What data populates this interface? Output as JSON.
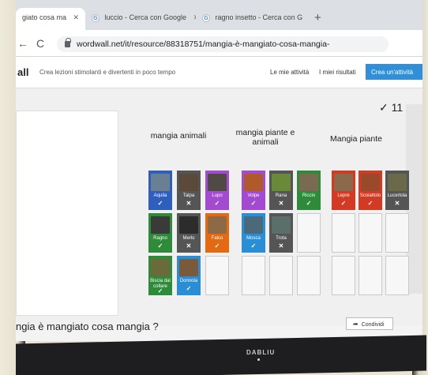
{
  "browser": {
    "tabs": [
      {
        "title": "giato cosa ma",
        "close": "✕"
      },
      {
        "title": "luccio - Cerca con Google",
        "close": "✕"
      },
      {
        "title": "ragno insetto - Cerca con G",
        "close": "✕"
      }
    ],
    "new_tab": "+",
    "back_icon": "←",
    "reload_icon": "C",
    "url": "wordwall.net/it/resource/88318751/mangia-è-mangiato-cosa-mangia-"
  },
  "header": {
    "logo": "all",
    "tagline": "Crea lezioni stimolanti e divertenti in poco tempo",
    "my_activities": "Le mie attività",
    "my_results": "I miei risultati",
    "create": "Crea un'attività"
  },
  "game": {
    "score_icon": "✓",
    "score": "11",
    "columns": [
      {
        "title": "mangia animali"
      },
      {
        "title": "mangia piante e animali"
      },
      {
        "title": "Mangia piante"
      }
    ],
    "cards": [
      {
        "label": "Aquila",
        "mark": "✓",
        "color": "#2e5fbf",
        "pic": "#6b7f92"
      },
      {
        "label": "Talpa",
        "mark": "✕",
        "color": "#555555",
        "pic": "#5b4a3a"
      },
      {
        "label": "Lupo",
        "mark": "✓",
        "color": "#a24bd0",
        "pic": "#4f4a44"
      },
      {
        "label": "Ragno",
        "mark": "✓",
        "color": "#2e8b3a",
        "pic": "#3a3a3a"
      },
      {
        "label": "Merlo",
        "mark": "✕",
        "color": "#555555",
        "pic": "#2c2c2c"
      },
      {
        "label": "Falco",
        "mark": "✓",
        "color": "#e36a12",
        "pic": "#8c6a45"
      },
      {
        "label": "Biscia dal collare",
        "mark": "✓",
        "color": "#2e8b3a",
        "pic": "#6a6a3a"
      },
      {
        "label": "Donnola",
        "mark": "✓",
        "color": "#2a8ed6",
        "pic": "#7a5a3a"
      },
      {
        "label": "Volpe",
        "mark": "✓",
        "color": "#a24bd0",
        "pic": "#b05a2a"
      },
      {
        "label": "Rana",
        "mark": "✕",
        "color": "#555555",
        "pic": "#6a8a3a"
      },
      {
        "label": "Riccio",
        "mark": "✓",
        "color": "#2e8b3a",
        "pic": "#7a6a52"
      },
      {
        "label": "Mosca",
        "mark": "✓",
        "color": "#2a8ed6",
        "pic": "#4a6a7a"
      },
      {
        "label": "Trota",
        "mark": "✕",
        "color": "#555555",
        "pic": "#5a6f6a"
      },
      {
        "label": "Lepre",
        "mark": "✓",
        "color": "#d23a24",
        "pic": "#8a6a4a"
      },
      {
        "label": "Scoiattolo",
        "mark": "✓",
        "color": "#d23a24",
        "pic": "#9a4a2a"
      },
      {
        "label": "Lucertola",
        "mark": "✕",
        "color": "#555555",
        "pic": "#6a6a4a"
      }
    ],
    "sound_icon": "◁)",
    "fullscreen_icon": "⛶"
  },
  "footer": {
    "title": "ngia è mangiato cosa mangia ?",
    "share": "Condividi",
    "share_icon": "➦"
  },
  "device": {
    "brand": "DABLIU"
  }
}
